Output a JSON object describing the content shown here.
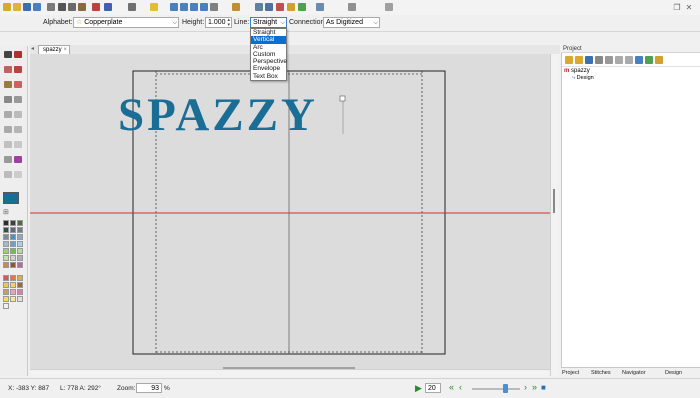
{
  "colors": {
    "accent": "#1a6e96",
    "selection": "#0a6fd0",
    "guide_red": "#d62c2c",
    "canvas_bg": "#dcdcdc"
  },
  "toolbar_top": {
    "icons": [
      "new-icon",
      "open-icon",
      "save-icon",
      "save-as-icon",
      "print-icon",
      "cut-icon",
      "copy-icon",
      "paste-icon",
      "undo-icon",
      "redo-icon",
      "stitch-player-icon",
      "help-icon",
      "zoom-in-icon",
      "zoom-out-icon",
      "zoom-fit-icon",
      "zoom-box-icon",
      "pan-icon",
      "ruler-icon",
      "measure-icon",
      "grid-icon",
      "hoop-icon",
      "thread-icon",
      "color-icon",
      "3d-view-icon",
      "trace-icon",
      "wizard-icon"
    ]
  },
  "toolbar_text": {
    "alphabet_label": "Alphabet:",
    "alphabet_value": "Copperplate",
    "height_label": "Height:",
    "height_value": "1.000",
    "line_label": "Line:",
    "line_value": "Straight",
    "connection_label": "Connection:",
    "connection_value": "As Digitized"
  },
  "line_dropdown": {
    "items": [
      "Straight",
      "Vertical",
      "Arc",
      "Custom",
      "Perspective",
      "Envelope",
      "Text Box"
    ],
    "highlighted": "Vertical"
  },
  "document": {
    "tab_title": "spazzy",
    "design_text": "SPAZZY"
  },
  "project_panel": {
    "title": "Project",
    "tree_root": "spazzy",
    "tree_child": "Design",
    "tabs": [
      "Project",
      "Stitches",
      "Navigator",
      "Design Checker"
    ]
  },
  "palette": [
    "#2b2b2b",
    "#3f3f3f",
    "#4b6e3a",
    "#2f4f4f",
    "#5e6b7a",
    "#6c7f8c",
    "#7b8a9a",
    "#4a90c8",
    "#8fa8bf",
    "#a5b8c8",
    "#6aa2cf",
    "#a8d0e6",
    "#9ad06a",
    "#6fbf4a",
    "#b8d99c",
    "#c7e0a8",
    "#d0d0d0",
    "#b0b0b0",
    "#c98a4a",
    "#8a5a2a",
    "#b56aa0",
    "#d45a5a",
    "#e07a3a",
    "#d8b04a",
    "#e8c85a",
    "#f0d070",
    "#9a6a3a",
    "#c0a070",
    "#e8a0c0",
    "#d880b0",
    "#f0e050",
    "#f5e890",
    "#e0e0e0",
    "#f0f0f0"
  ],
  "status": {
    "coords": "X: -383  Y: 887",
    "length": "L: 778  A: 292°",
    "zoom_label": "Zoom:",
    "zoom_value": "93",
    "zoom_unit": "%",
    "speed_value": "20"
  }
}
